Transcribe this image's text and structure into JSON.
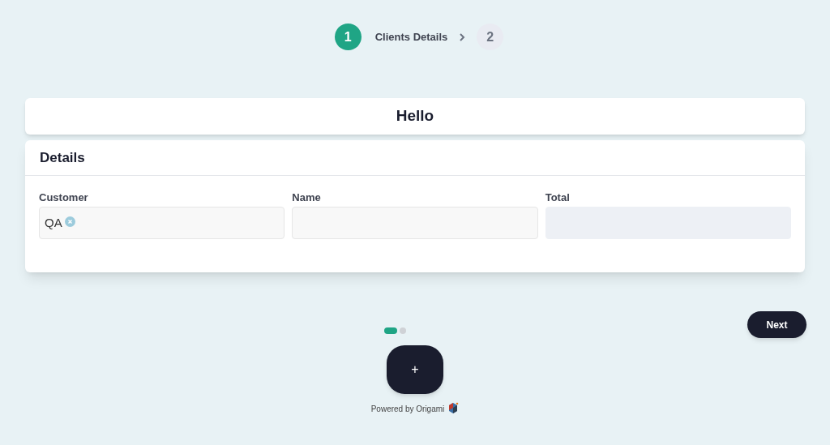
{
  "steps": [
    {
      "number": "1",
      "label": "Clients Details",
      "selected": true
    },
    {
      "number": "2",
      "selected": false
    }
  ],
  "header": {
    "title": "Hello"
  },
  "section": {
    "title": "Details",
    "fields": [
      {
        "label": "Customer",
        "kind": "tags",
        "tags": [
          "QA"
        ]
      },
      {
        "label": "Name",
        "kind": "text"
      },
      {
        "label": "Total",
        "kind": "text",
        "disabled": true
      }
    ]
  },
  "pager": [
    {
      "selected": true
    },
    {
      "selected": false
    }
  ],
  "next_button": "Next",
  "add_button": "+",
  "footer": "Powered by Origami"
}
